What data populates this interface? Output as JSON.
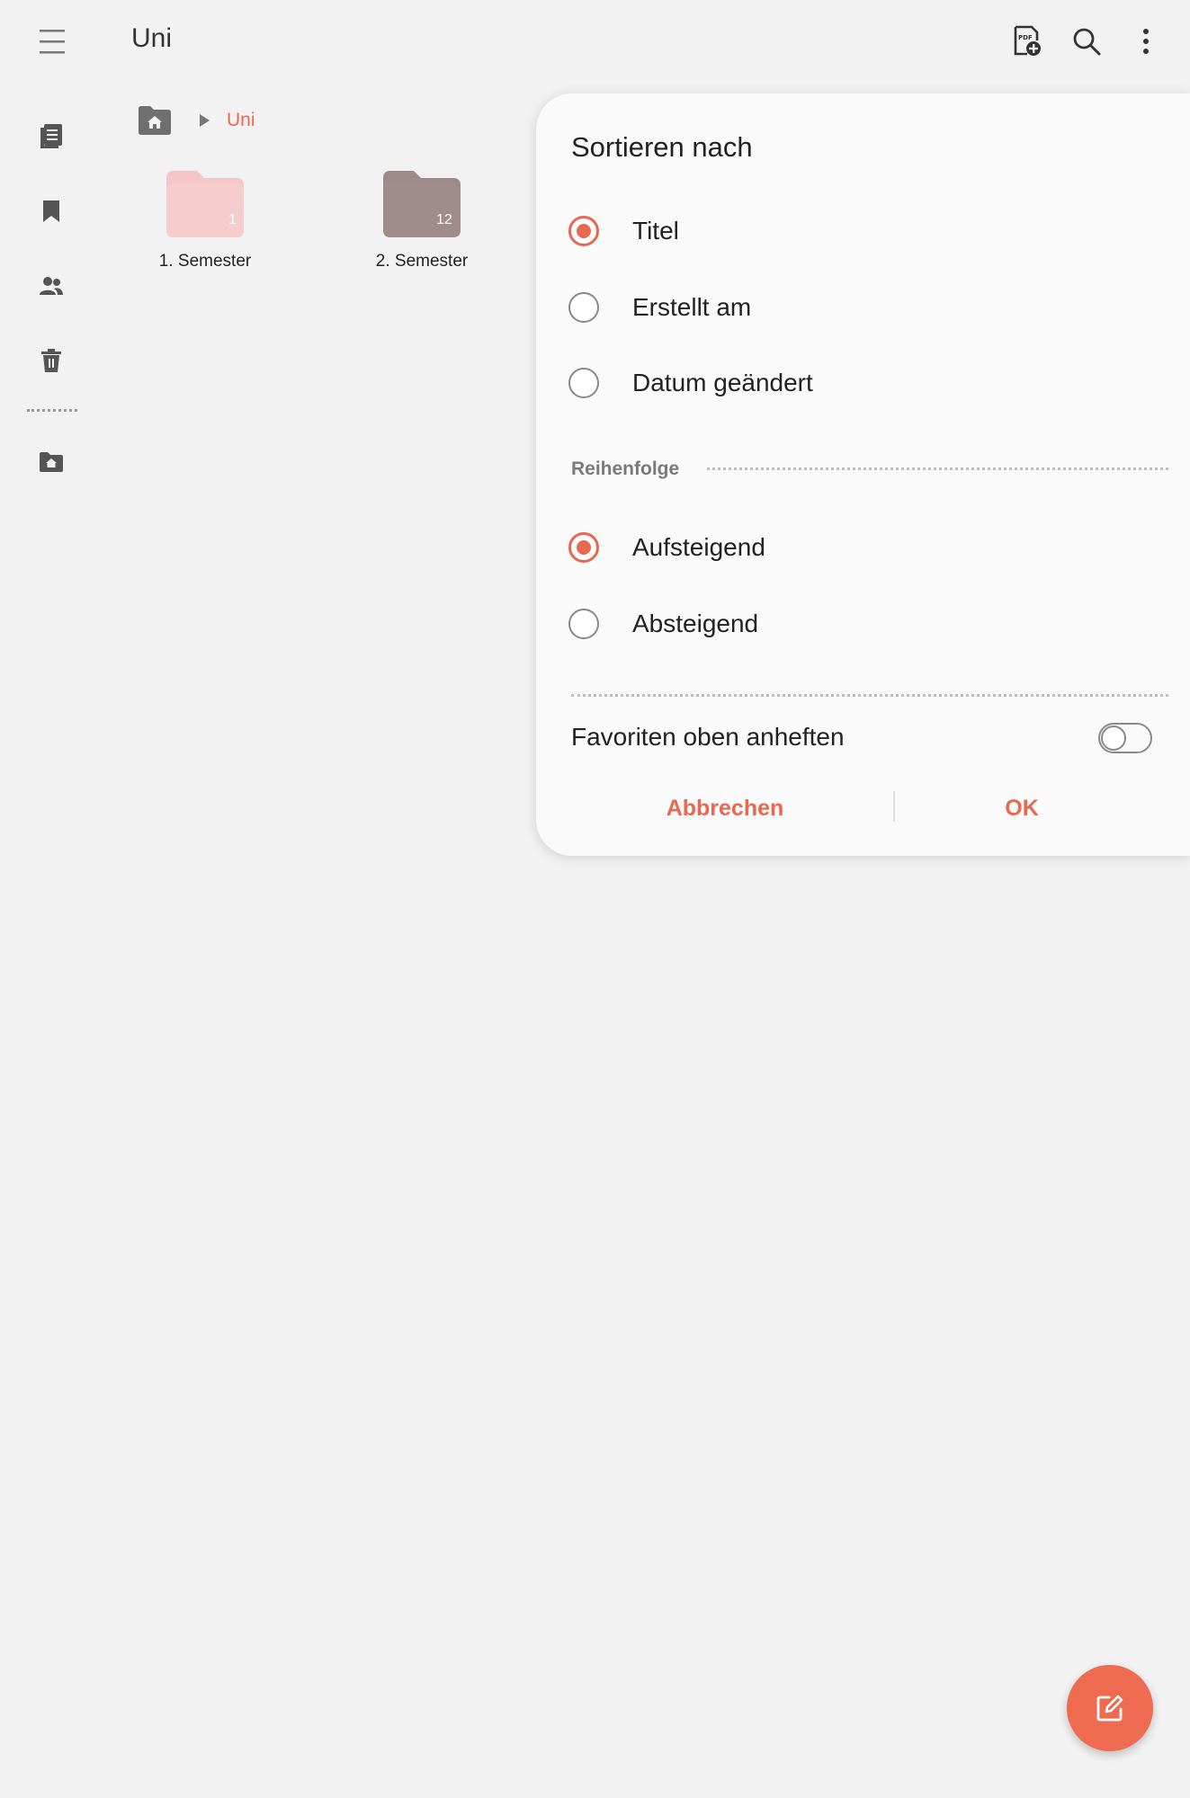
{
  "app": {
    "title": "Uni"
  },
  "top_actions": [
    "pdf-add-icon",
    "search-icon",
    "more-options-icon"
  ],
  "rail": {
    "items": [
      "notes-icon",
      "bookmark-icon",
      "shared-icon",
      "trash-icon",
      "home-folder-icon"
    ]
  },
  "breadcrumb": {
    "current": "Uni"
  },
  "folders": [
    {
      "label": "1. Semester",
      "count": "1",
      "color": "#f5c6c6"
    },
    {
      "label": "2. Semester",
      "count": "12",
      "color": "#9e8a88"
    }
  ],
  "sort_dialog": {
    "title": "Sortieren nach",
    "sort_options": [
      {
        "label": "Titel",
        "selected": true
      },
      {
        "label": "Erstellt am",
        "selected": false
      },
      {
        "label": "Datum geändert",
        "selected": false
      }
    ],
    "order_section_label": "Reihenfolge",
    "order_options": [
      {
        "label": "Aufsteigend",
        "selected": true
      },
      {
        "label": "Absteigend",
        "selected": false
      }
    ],
    "pin_favorites_label": "Favoriten oben anheften",
    "pin_favorites_enabled": false,
    "cancel_label": "Abbrechen",
    "ok_label": "OK"
  },
  "colors": {
    "accent": "#e8694f",
    "background": "#f2f2f2",
    "dialog": "#fafafa"
  }
}
